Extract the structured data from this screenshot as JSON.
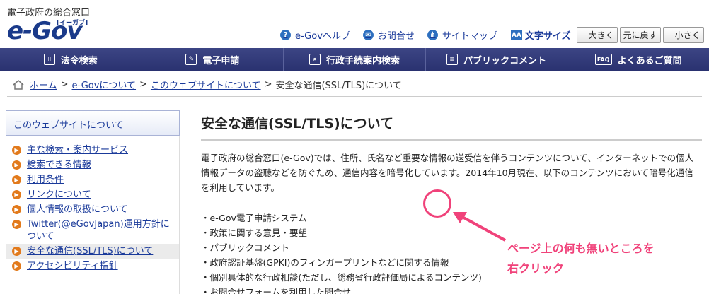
{
  "header": {
    "site_sub": "電子政府の総合窓口",
    "logo_main": "e-Gov",
    "logo_sub": "[イーガブ]"
  },
  "util_nav": {
    "help": "e-Govヘルプ",
    "contact": "お問合せ",
    "sitemap": "サイトマップ",
    "font_label": "文字サイズ",
    "bigger": "＋大きく",
    "reset": "元に戻す",
    "smaller": "－小さく"
  },
  "gnav": [
    {
      "label": "法令検索",
      "icon": "book-icon"
    },
    {
      "label": "電子申請",
      "icon": "pen-icon"
    },
    {
      "label": "行政手続案内検索",
      "icon": "search-icon"
    },
    {
      "label": "パブリックコメント",
      "icon": "comment-icon"
    },
    {
      "label": "よくあるご質問",
      "icon": "faq-icon"
    }
  ],
  "breadcrumb": {
    "home": "ホーム",
    "about": "e-Govについて",
    "website": "このウェブサイトについて",
    "current": "安全な通信(SSL/TLS)について",
    "sep": ">"
  },
  "sidebar": {
    "heading": "このウェブサイトについて",
    "items": [
      {
        "label": "主な検索・案内サービス"
      },
      {
        "label": "検索できる情報"
      },
      {
        "label": "利用条件"
      },
      {
        "label": "リンクについて"
      },
      {
        "label": "個人情報の取扱について"
      },
      {
        "label": "Twitter(@eGovJapan)運用方針について"
      },
      {
        "label": "安全な通信(SSL/TLS)について"
      },
      {
        "label": "アクセシビリティ指針"
      }
    ]
  },
  "main": {
    "title": "安全な通信(SSL/TLS)について",
    "intro": "電子政府の総合窓口(e-Gov)では、住所、氏名など重要な情報の送受信を伴うコンテンツについて、インターネットでの個人情報データの盗聴などを防ぐため、通信内容を暗号化しています。2014年10月現在、以下のコンテンツにおいて暗号化通信を利用しています。",
    "bullets": [
      "・e-Gov電子申請システム",
      "・政策に関する意見・要望",
      "・パブリックコメント",
      "・政府認証基盤(GPKI)のフィンガープリントなどに関する情報",
      "・個別具体的な行政相談(ただし、総務省行政評価局によるコンテンツ)",
      "・お問合せフォームを利用した問合せ"
    ]
  },
  "annotation": {
    "line1": "ページ上の何も無いところを",
    "line2": "右クリック",
    "color": "#f0427a"
  }
}
